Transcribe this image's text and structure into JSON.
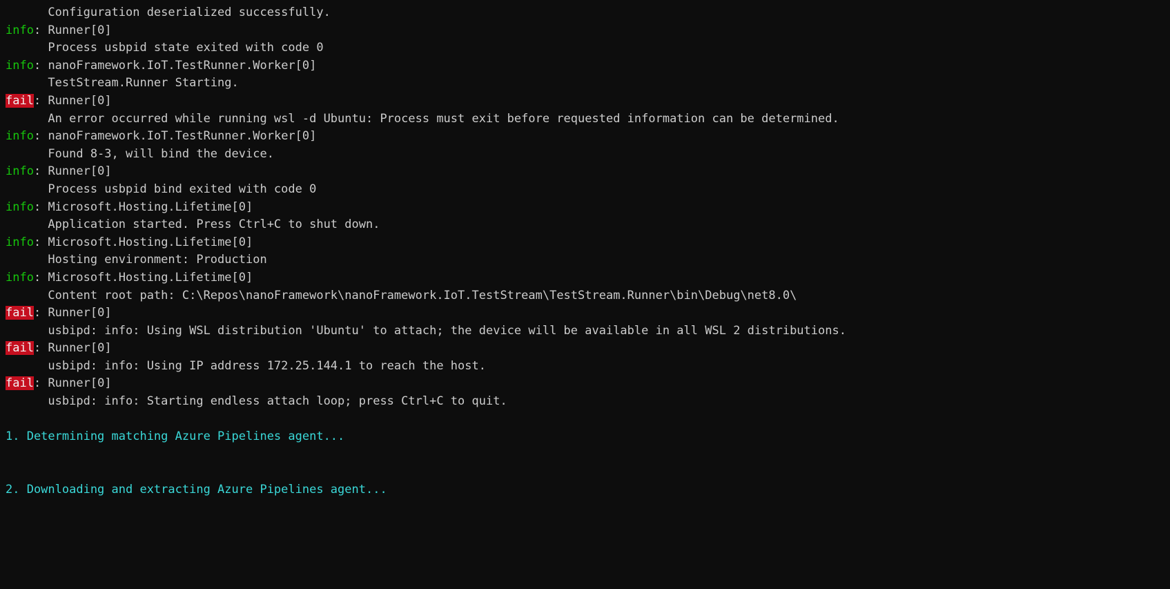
{
  "terminal": {
    "background_color": "#0d0d0d",
    "default_text_color": "#cccccc",
    "info_label_color": "#16c60c",
    "fail_label_bg_color": "#c50f1f",
    "fail_label_text_color": "#f2f2f2",
    "cyan_text_color": "#3ad8d8",
    "indent": "      ",
    "separator": ": ",
    "lines": [
      {
        "kind": "message",
        "text": "      Configuration deserialized successfully."
      },
      {
        "kind": "header",
        "level": "info",
        "label": "info",
        "category": "Runner[0]"
      },
      {
        "kind": "message",
        "text": "      Process usbpid state exited with code 0"
      },
      {
        "kind": "header",
        "level": "info",
        "label": "info",
        "category": "nanoFramework.IoT.TestRunner.Worker[0]"
      },
      {
        "kind": "message",
        "text": "      TestStream.Runner Starting."
      },
      {
        "kind": "header",
        "level": "fail",
        "label": "fail",
        "category": "Runner[0]"
      },
      {
        "kind": "message",
        "text": "      An error occurred while running wsl -d Ubuntu: Process must exit before requested information can be determined."
      },
      {
        "kind": "header",
        "level": "info",
        "label": "info",
        "category": "nanoFramework.IoT.TestRunner.Worker[0]"
      },
      {
        "kind": "message",
        "text": "      Found 8-3, will bind the device."
      },
      {
        "kind": "header",
        "level": "info",
        "label": "info",
        "category": "Runner[0]"
      },
      {
        "kind": "message",
        "text": "      Process usbpid bind exited with code 0"
      },
      {
        "kind": "header",
        "level": "info",
        "label": "info",
        "category": "Microsoft.Hosting.Lifetime[0]"
      },
      {
        "kind": "message",
        "text": "      Application started. Press Ctrl+C to shut down."
      },
      {
        "kind": "header",
        "level": "info",
        "label": "info",
        "category": "Microsoft.Hosting.Lifetime[0]"
      },
      {
        "kind": "message",
        "text": "      Hosting environment: Production"
      },
      {
        "kind": "header",
        "level": "info",
        "label": "info",
        "category": "Microsoft.Hosting.Lifetime[0]"
      },
      {
        "kind": "message",
        "text": "      Content root path: C:\\Repos\\nanoFramework\\nanoFramework.IoT.TestStream\\TestStream.Runner\\bin\\Debug\\net8.0\\"
      },
      {
        "kind": "header",
        "level": "fail",
        "label": "fail",
        "category": "Runner[0]"
      },
      {
        "kind": "message",
        "text": "      usbipd: info: Using WSL distribution 'Ubuntu' to attach; the device will be available in all WSL 2 distributions."
      },
      {
        "kind": "header",
        "level": "fail",
        "label": "fail",
        "category": "Runner[0]"
      },
      {
        "kind": "message",
        "text": "      usbipd: info: Using IP address 172.25.144.1 to reach the host."
      },
      {
        "kind": "header",
        "level": "fail",
        "label": "fail",
        "category": "Runner[0]"
      },
      {
        "kind": "message",
        "text": "      usbipd: info: Starting endless attach loop; press Ctrl+C to quit."
      },
      {
        "kind": "blank",
        "text": ""
      },
      {
        "kind": "cyan",
        "text": "1. Determining matching Azure Pipelines agent..."
      },
      {
        "kind": "blank",
        "text": ""
      },
      {
        "kind": "blank",
        "text": ""
      },
      {
        "kind": "cyan",
        "text": "2. Downloading and extracting Azure Pipelines agent..."
      },
      {
        "kind": "blank",
        "text": ""
      },
      {
        "kind": "blank",
        "text": ""
      }
    ]
  }
}
